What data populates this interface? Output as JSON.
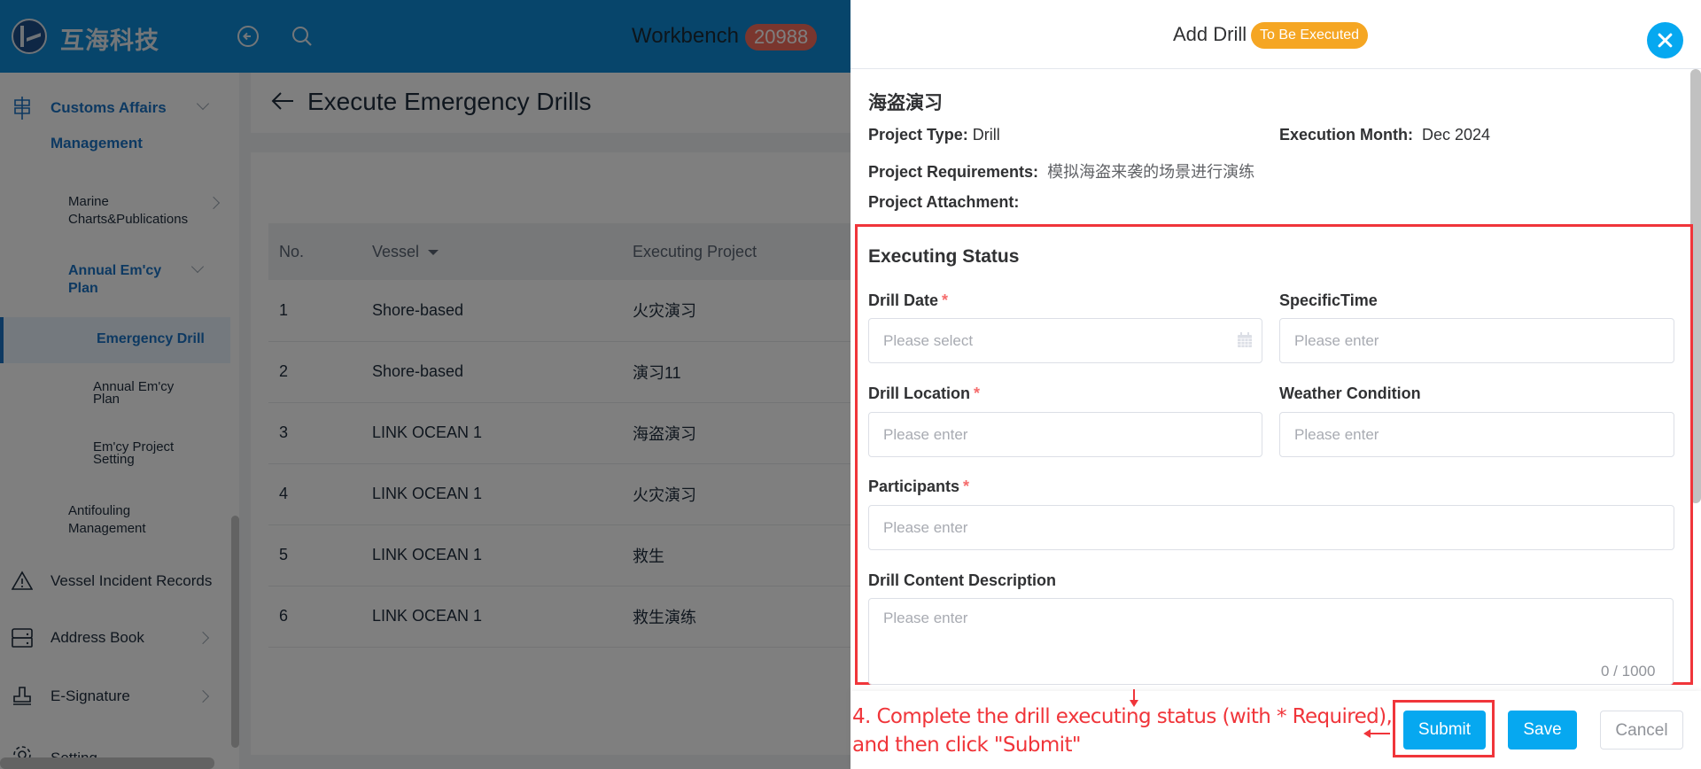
{
  "header": {
    "brand": "互海科技",
    "workbench_label": "Workbench",
    "workbench_count": "20988",
    "icons": [
      "back-circle-icon",
      "search-icon"
    ]
  },
  "sidebar": {
    "group": {
      "label_line1": "Customs Affairs",
      "label_line2": "Management",
      "icon": "signpost-icon",
      "expanded": true
    },
    "items": [
      {
        "label_line1": "Marine",
        "label_line2": "Charts&Publications",
        "has_children": true
      },
      {
        "label_line1": "Annual Em'cy",
        "label_line2": "Plan",
        "expanded": true
      },
      {
        "label": "Emergency Drill",
        "active": true
      },
      {
        "label_line1": "Annual Em'cy",
        "label_line2": "Plan"
      },
      {
        "label_line1": "Em'cy Project",
        "label_line2": "Setting"
      },
      {
        "label_line1": "Antifouling",
        "label_line2": "Management"
      }
    ],
    "top_items": [
      {
        "label": "Vessel Incident Records",
        "icon": "warning-icon"
      },
      {
        "label": "Address Book",
        "icon": "address-book-icon",
        "has_children": true
      },
      {
        "label": "E-Signature",
        "icon": "stamp-icon",
        "has_children": true
      },
      {
        "label": "Setting",
        "icon": "gear-icon",
        "has_children": true
      }
    ]
  },
  "page": {
    "title": "Execute Emergency Drills",
    "table": {
      "columns": [
        "No.",
        "Vessel",
        "Executing Project"
      ],
      "rows": [
        {
          "no": "1",
          "vessel": "Shore-based",
          "project": "火灾演习"
        },
        {
          "no": "2",
          "vessel": "Shore-based",
          "project": "演习11"
        },
        {
          "no": "3",
          "vessel": "LINK OCEAN 1",
          "project": "海盗演习"
        },
        {
          "no": "4",
          "vessel": "LINK OCEAN 1",
          "project": "火灾演习"
        },
        {
          "no": "5",
          "vessel": "LINK OCEAN 1",
          "project": "救生"
        },
        {
          "no": "6",
          "vessel": "LINK OCEAN 1",
          "project": "救生演练"
        }
      ]
    }
  },
  "drawer": {
    "title": "Add Drill",
    "status": "To Be Executed",
    "project_name": "海盗演习",
    "project_type_label": "Project Type:",
    "project_type": "Drill",
    "execution_month_label": "Execution Month:",
    "execution_month": "Dec 2024",
    "requirements_label": "Project Requirements:",
    "requirements": "模拟海盗来袭的场景进行演练",
    "attachment_label": "Project Attachment:",
    "section_title": "Executing Status",
    "fields": {
      "drill_date": {
        "label": "Drill Date",
        "required": "*",
        "placeholder": "Please select",
        "value": ""
      },
      "specific_time": {
        "label": "SpecificTime",
        "placeholder": "Please enter",
        "value": ""
      },
      "drill_location": {
        "label": "Drill Location",
        "required": "*",
        "placeholder": "Please enter",
        "value": ""
      },
      "weather": {
        "label": "Weather Condition",
        "placeholder": "Please enter",
        "value": ""
      },
      "participants": {
        "label": "Participants",
        "required": "*",
        "placeholder": "Please enter",
        "value": ""
      },
      "description": {
        "label": "Drill Content Description",
        "placeholder": "Please enter",
        "value": "",
        "count": "0 / 1000"
      }
    },
    "buttons": {
      "submit": "Submit",
      "save": "Save",
      "cancel": "Cancel"
    },
    "annotation_line1": "4. Complete the drill executing status (with * Required),",
    "annotation_line2": "and then click \"Submit\""
  },
  "colors": {
    "header": "#0f8bd6",
    "accent": "#06a8f0",
    "status_badge": "#f5a623",
    "annotation": "#f0353a",
    "required": "#f56c6c",
    "workbench_badge": "#f56c5c"
  }
}
